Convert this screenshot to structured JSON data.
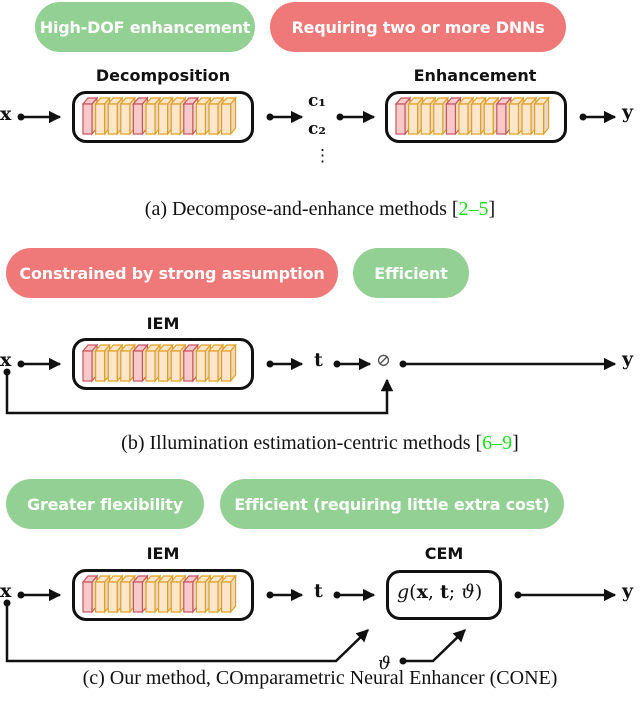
{
  "panel_a": {
    "tags": [
      {
        "text": "High-DOF enhancement",
        "kind": "pro",
        "color": "#93d093"
      },
      {
        "text": "Requiring two or more DNNs",
        "kind": "con",
        "color": "#ef7878"
      }
    ],
    "input": "x",
    "module1_label": "Decomposition",
    "components": [
      "c₁",
      "c₂",
      "⋮"
    ],
    "module2_label": "Enhancement",
    "output": "y",
    "caption_prefix": "(a) Decompose-and-enhance methods [",
    "caption_cite": "2–5",
    "caption_suffix": "]"
  },
  "panel_b": {
    "tags": [
      {
        "text": "Constrained by strong assumption",
        "kind": "con",
        "color": "#ef7878"
      },
      {
        "text": "Efficient",
        "kind": "pro",
        "color": "#93d093"
      }
    ],
    "input": "x",
    "module_label": "IEM",
    "intermediate": "t",
    "operator": "⊘",
    "output": "y",
    "caption_prefix": "(b) Illumination estimation-centric methods [",
    "caption_cite": "6–9",
    "caption_suffix": "]"
  },
  "panel_c": {
    "tags": [
      {
        "text": "Greater flexibility",
        "kind": "pro",
        "color": "#93d093"
      },
      {
        "text": "Efficient (requiring little extra cost)",
        "kind": "pro",
        "color": "#93d093"
      }
    ],
    "input": "x",
    "module1_label": "IEM",
    "intermediate": "t",
    "module2_label": "CEM",
    "function_name": "g",
    "function_args": {
      "open": "(",
      "x": "x",
      "sep1": ", ",
      "t": "t",
      "sep2": "; ",
      "theta": "ϑ",
      "close": ")"
    },
    "param": "ϑ",
    "output": "y",
    "caption": "(c) Our method, COmparametric Neural Enhancer (CONE)"
  },
  "block_pattern": [
    "pink",
    "orange",
    "orange",
    "orange",
    "pink",
    "orange",
    "orange",
    "orange",
    "pink",
    "orange",
    "orange",
    "orange"
  ],
  "colors": {
    "pink_face": "#f7c9c9",
    "pink_edge": "#c8555f",
    "orange_face": "#fde6cc",
    "orange_edge": "#e0a020",
    "side_shade": "#ead7c4",
    "line": "#111111"
  }
}
